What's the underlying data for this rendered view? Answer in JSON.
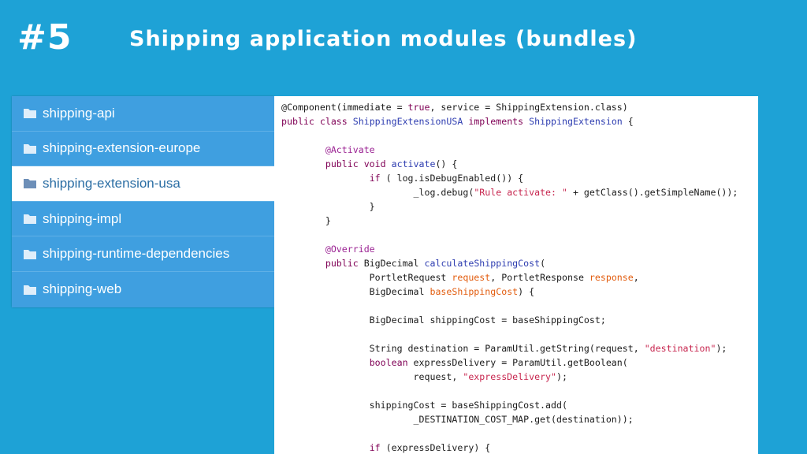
{
  "header": {
    "slide_number": "#5",
    "title": "Shipping application modules (bundles)"
  },
  "modules": [
    {
      "label": "shipping-api",
      "selected": false
    },
    {
      "label": "shipping-extension-europe",
      "selected": false
    },
    {
      "label": "shipping-extension-usa",
      "selected": true
    },
    {
      "label": "shipping-impl",
      "selected": false
    },
    {
      "label": "shipping-runtime-dependencies",
      "selected": false
    },
    {
      "label": "shipping-web",
      "selected": false
    }
  ],
  "code": [
    [
      [
        "plain",
        "@Component(immediate = "
      ],
      [
        "kw",
        "true"
      ],
      [
        "plain",
        ", service = ShippingExtension.class)"
      ]
    ],
    [
      [
        "kw",
        "public class "
      ],
      [
        "type",
        "ShippingExtensionUSA "
      ],
      [
        "kw",
        "implements "
      ],
      [
        "type",
        "ShippingExtension"
      ],
      [
        "plain",
        " {"
      ]
    ],
    [],
    [
      [
        "plain",
        "        "
      ],
      [
        "ann",
        "@Activate"
      ]
    ],
    [
      [
        "plain",
        "        "
      ],
      [
        "kw",
        "public void "
      ],
      [
        "type",
        "activate"
      ],
      [
        "plain",
        "() {"
      ]
    ],
    [
      [
        "plain",
        "                "
      ],
      [
        "kw",
        "if"
      ],
      [
        "plain",
        " ( log.isDebugEnabled()) {"
      ]
    ],
    [
      [
        "plain",
        "                        _log.debug("
      ],
      [
        "str",
        "\"Rule activate: \""
      ],
      [
        "plain",
        " + getClass().getSimpleName());"
      ]
    ],
    [
      [
        "plain",
        "                }"
      ]
    ],
    [
      [
        "plain",
        "        }"
      ]
    ],
    [],
    [
      [
        "plain",
        "        "
      ],
      [
        "ann",
        "@Override"
      ]
    ],
    [
      [
        "plain",
        "        "
      ],
      [
        "kw",
        "public "
      ],
      [
        "plain",
        "BigDecimal "
      ],
      [
        "type",
        "calculateShippingCost"
      ],
      [
        "plain",
        "("
      ]
    ],
    [
      [
        "plain",
        "                PortletRequest "
      ],
      [
        "var",
        "request"
      ],
      [
        "plain",
        ", PortletResponse "
      ],
      [
        "var",
        "response"
      ],
      [
        "plain",
        ","
      ]
    ],
    [
      [
        "plain",
        "                BigDecimal "
      ],
      [
        "var",
        "baseShippingCost"
      ],
      [
        "plain",
        ") {"
      ]
    ],
    [],
    [
      [
        "plain",
        "                BigDecimal shippingCost = baseShippingCost;"
      ]
    ],
    [],
    [
      [
        "plain",
        "                String destination = ParamUtil.getString(request, "
      ],
      [
        "str",
        "\"destination\""
      ],
      [
        "plain",
        ");"
      ]
    ],
    [
      [
        "plain",
        "                "
      ],
      [
        "kw",
        "boolean "
      ],
      [
        "plain",
        "expressDelivery = ParamUtil.getBoolean("
      ]
    ],
    [
      [
        "plain",
        "                        request, "
      ],
      [
        "str",
        "\"expressDelivery\""
      ],
      [
        "plain",
        ");"
      ]
    ],
    [],
    [
      [
        "plain",
        "                shippingCost = baseShippingCost.add("
      ]
    ],
    [
      [
        "plain",
        "                        _DESTINATION_COST_MAP.get(destination));"
      ]
    ],
    [],
    [
      [
        "plain",
        "                "
      ],
      [
        "kw",
        "if"
      ],
      [
        "plain",
        " (expressDelivery) {"
      ]
    ]
  ],
  "colors": {
    "background": "#1ea2d6",
    "tree_bg": "#3f9fe0",
    "selected_bg": "#ffffff",
    "keyword": "#7f0055",
    "annotation": "#9b2393",
    "string": "#c7254e",
    "param": "#e25c0e"
  },
  "icons": {
    "folder": "folder-icon"
  }
}
